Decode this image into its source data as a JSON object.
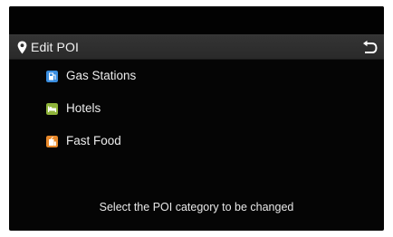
{
  "header": {
    "title": "Edit POI",
    "title_icon": "map-pin-icon",
    "back_icon": "back-arrow-icon"
  },
  "categories": [
    {
      "label": "Gas Stations",
      "icon": "gas-station-icon",
      "color": "#3a8ee0"
    },
    {
      "label": "Hotels",
      "icon": "hotel-icon",
      "color": "#8fb43a"
    },
    {
      "label": "Fast Food",
      "icon": "fast-food-icon",
      "color": "#e8892b"
    }
  ],
  "footer": {
    "hint": "Select the POI category to be changed"
  },
  "colors": {
    "screen_background": "#050505",
    "title_bar": "#303030",
    "text": "#f2f2f2"
  }
}
